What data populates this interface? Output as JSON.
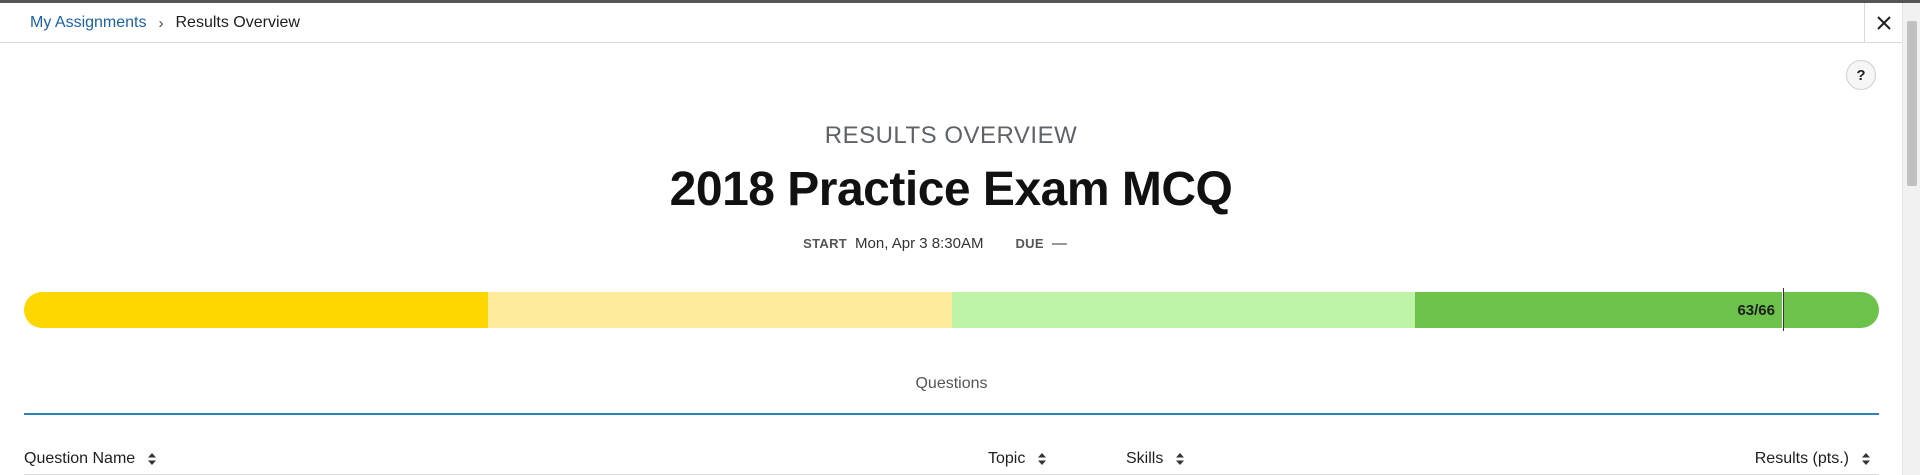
{
  "breadcrumb": {
    "link": "My Assignments",
    "current": "Results Overview"
  },
  "header": {
    "overview_label": "RESULTS OVERVIEW",
    "title": "2018 Practice Exam MCQ",
    "start_label": "START",
    "start_value": "Mon, Apr 3 8:30AM",
    "due_label": "DUE",
    "due_value": "—"
  },
  "progress": {
    "score_text": "63/66",
    "score": 63,
    "max": 66,
    "segments": [
      {
        "color": "#ffd700",
        "fraction": 0.25
      },
      {
        "color": "#ffeb9c",
        "fraction": 0.25
      },
      {
        "color": "#bff3a8",
        "fraction": 0.25
      },
      {
        "color": "#6cc24a",
        "fraction": 0.25
      }
    ]
  },
  "tabs": {
    "questions": "Questions"
  },
  "table": {
    "columns": {
      "question_name": "Question Name",
      "topic": "Topic",
      "skills": "Skills",
      "results": "Results (pts.)"
    }
  },
  "help_label": "?",
  "icons": {
    "close": "close-icon",
    "sort": "sort-icon",
    "chevron": "chevron-right-icon",
    "help": "help-icon"
  },
  "colors": {
    "link": "#1a62a6",
    "tab_underline": "#2b82b6"
  }
}
